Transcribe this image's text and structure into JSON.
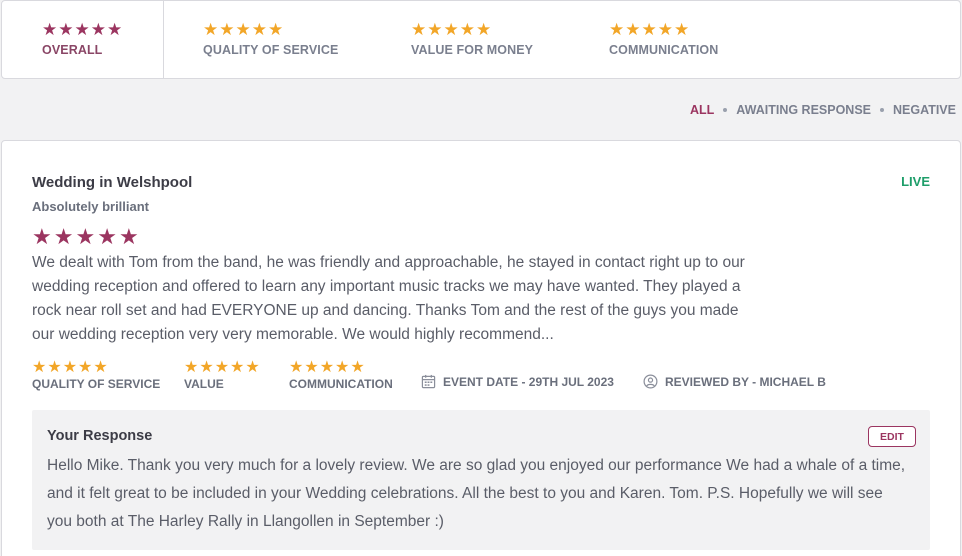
{
  "summary": {
    "items": [
      {
        "label": "OVERALL",
        "rating": 5
      },
      {
        "label": "QUALITY OF SERVICE",
        "rating": 5
      },
      {
        "label": "VALUE FOR MONEY",
        "rating": 5
      },
      {
        "label": "COMMUNICATION",
        "rating": 5
      }
    ]
  },
  "filters": {
    "all": "ALL",
    "awaiting": "AWAITING RESPONSE",
    "negative": "NEGATIVE"
  },
  "review": {
    "title": "Wedding in Welshpool",
    "subtitle": "Absolutely brilliant",
    "status": "LIVE",
    "rating": 5,
    "body": "We dealt with Tom from the band, he was friendly and approachable, he stayed in contact right up to our wedding reception and offered to learn any important music tracks we may have wanted. They played a rock near roll set and had EVERYONE up and dancing. Thanks Tom and the rest of the guys you made our wedding reception very very memorable. We would highly recommend...",
    "ratings": [
      {
        "label": "QUALITY OF SERVICE",
        "rating": 5
      },
      {
        "label": "VALUE",
        "rating": 5
      },
      {
        "label": "COMMUNICATION",
        "rating": 5
      }
    ],
    "event_date": "EVENT DATE - 29TH JUL 2023",
    "reviewed_by": "REVIEWED BY - MICHAEL B"
  },
  "response": {
    "title": "Your Response",
    "edit_label": "EDIT",
    "text": "Hello Mike. Thank you very much for a lovely review. We are so glad you enjoyed our performance We had a whale of a time, and it felt great to be included in your Wedding celebrations. All the best to you and Karen. Tom. P.S. Hopefully we will see you both at The Harley Rally in Llangollen in September :)"
  },
  "icons": {
    "star": "star-icon",
    "calendar": "calendar-icon",
    "user": "user-circle-icon"
  },
  "colors": {
    "brand": "#9b3560",
    "gold_star": "#f2a628",
    "live": "#1e9e6a"
  }
}
